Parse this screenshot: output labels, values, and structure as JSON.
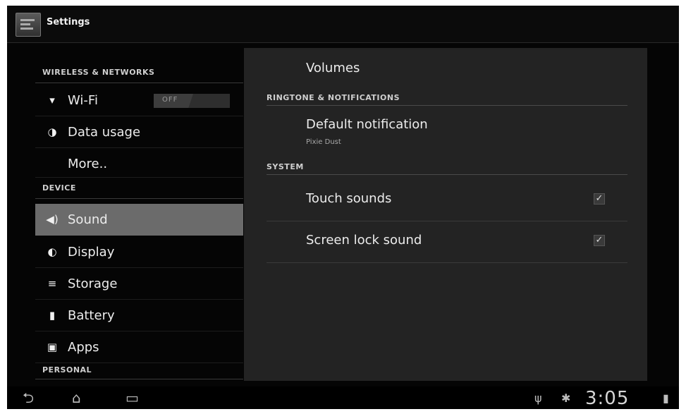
{
  "app": {
    "title": "Settings",
    "icon": "settings-icon"
  },
  "sidebar": {
    "sections": [
      {
        "header": "WIRELESS & NETWORKS"
      },
      {
        "header": "DEVICE"
      },
      {
        "header": "PERSONAL"
      }
    ],
    "items": [
      {
        "label": "Wi-Fi",
        "icon": "wifi-icon",
        "toggle": "OFF"
      },
      {
        "label": "Data usage",
        "icon": "data-usage-icon"
      },
      {
        "label": "More..",
        "icon": ""
      },
      {
        "label": "Sound",
        "icon": "sound-icon",
        "selected": true
      },
      {
        "label": "Display",
        "icon": "display-icon"
      },
      {
        "label": "Storage",
        "icon": "storage-icon"
      },
      {
        "label": "Battery",
        "icon": "battery-icon"
      },
      {
        "label": "Apps",
        "icon": "apps-icon"
      }
    ]
  },
  "main": {
    "volumes": "Volumes",
    "ringtone_header": "RINGTONE & NOTIFICATIONS",
    "default_notification": {
      "title": "Default notification",
      "summary": "Pixie Dust"
    },
    "system_header": "SYSTEM",
    "touch_sounds": {
      "title": "Touch sounds",
      "checked": true
    },
    "screen_lock_sound": {
      "title": "Screen lock sound",
      "checked": true
    }
  },
  "navbar": {
    "clock": "3:05",
    "buttons": [
      "back-icon",
      "home-icon",
      "recent-apps-icon"
    ],
    "status_icons": [
      "usb-icon",
      "android-debug-icon",
      "battery-status-icon"
    ]
  },
  "colors": {
    "selected_bg": "#6b6b6b",
    "pane_bg": "#232323",
    "screen_bg": "#050505"
  }
}
